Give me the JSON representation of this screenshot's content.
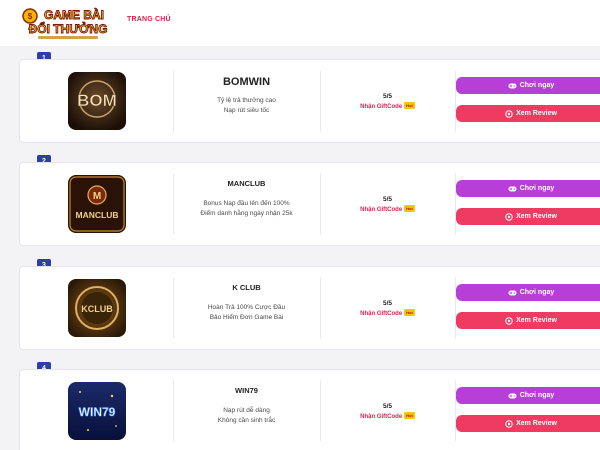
{
  "header": {
    "logo_text_line1": "GAME BÀI",
    "logo_text_line2": "ĐỔI THƯỞNG",
    "nav_home": "TRANG CHỦ"
  },
  "games": [
    {
      "rank": "1",
      "name": "BOMWIN",
      "logo_text": "BOM",
      "desc_line1": "Tỷ lệ trả thưởng cao",
      "desc_line2": "Nạp rút siêu tốc",
      "score": "5/5",
      "gift": "Nhận GiftCode",
      "hot": "Hot",
      "play_label": "Chơi ngay",
      "review_label": "Xem Review"
    },
    {
      "rank": "2",
      "name": "MANCLUB",
      "logo_text": "MANCLUB",
      "desc_line1": "Bonus Nạp đầu lên đến 100%",
      "desc_line2": "Điểm danh hằng ngày nhận 25k",
      "score": "5/5",
      "gift": "Nhận GiftCode",
      "hot": "Hot",
      "play_label": "Chơi ngay",
      "review_label": "Xem Review"
    },
    {
      "rank": "3",
      "name": "K CLUB",
      "logo_text": "KCLUB",
      "desc_line1": "Hoàn Trả 100% Cược Đầu",
      "desc_line2": "Bảo Hiểm Đơn Game Bài",
      "score": "5/5",
      "gift": "Nhận GiftCode",
      "hot": "Hot",
      "play_label": "Chơi ngay",
      "review_label": "Xem Review"
    },
    {
      "rank": "4",
      "name": "WIN79",
      "logo_text": "WIN79",
      "desc_line1": "Nạp rút dễ dàng",
      "desc_line2": "Không cần sinh trắc",
      "score": "5/5",
      "gift": "Nhận GiftCode",
      "hot": "Hot",
      "play_label": "Chơi ngay",
      "review_label": "Xem Review"
    }
  ],
  "colors": {
    "accent_red": "#e0204f",
    "play_button": "#b73ed6",
    "review_button": "#ef3a62",
    "rank_badge": "#2d3fa3"
  },
  "icons": {
    "play": "gamepad-icon",
    "review": "eye-icon"
  }
}
